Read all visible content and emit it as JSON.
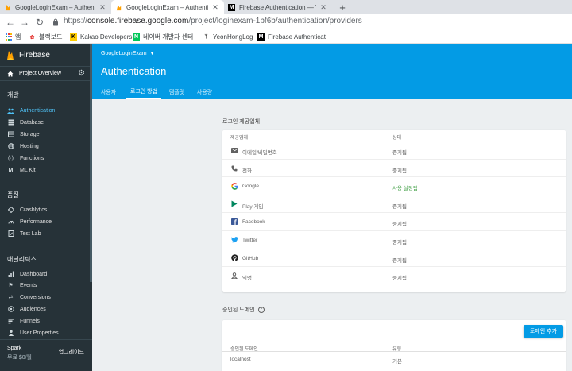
{
  "browser": {
    "tabs": [
      {
        "title": "GoogleLoginExam – Authentica",
        "icon": "firebase-icon"
      },
      {
        "title": "GoogleLoginExam – Authenticati",
        "icon": "firebase-icon"
      },
      {
        "title": "Firebase Authentication — 'Go",
        "icon": "medium-icon"
      }
    ],
    "url_prefix": "https://",
    "url_host": "console.firebase.google.com",
    "url_path": "/project/loginexam-1bf6b/authentication/providers",
    "bookmarks": [
      {
        "label": "앱",
        "icon": "apps-icon"
      },
      {
        "label": "블랙보드",
        "icon": "blackboard-icon"
      },
      {
        "label": "Kakao Developers",
        "icon": "kakao-icon"
      },
      {
        "label": "네이버 개발자 센터",
        "icon": "naver-icon"
      },
      {
        "label": "YeonHongLog",
        "icon": "velog-icon"
      },
      {
        "label": "Firebase Authenticat",
        "icon": "medium-icon"
      }
    ]
  },
  "sidebar": {
    "brand": "Firebase",
    "overview": "Project Overview",
    "sections": {
      "develop": "개발",
      "quality": "품질",
      "analytics": "애널리틱스"
    },
    "develop_items": [
      "Authentication",
      "Database",
      "Storage",
      "Hosting",
      "Functions",
      "ML Kit"
    ],
    "quality_items": [
      "Crashlytics",
      "Performance",
      "Test Lab"
    ],
    "analytics_items": [
      "Dashboard",
      "Events",
      "Conversions",
      "Audiences",
      "Funnels",
      "User Properties"
    ],
    "plan": "Spark",
    "price": "무료 $0/월",
    "upgrade": "업그레이드"
  },
  "header": {
    "project": "GoogleLoginExam",
    "title": "Authentication",
    "tabs": [
      "사용자",
      "로그인 방법",
      "템플릿",
      "사용량"
    ],
    "active_tab": "로그인 방법"
  },
  "providers": {
    "section_label": "로그인 제공업체",
    "col_provider": "제공업체",
    "col_status": "상태",
    "rows": [
      {
        "name": "이메일/비밀번호",
        "status": "중지됨",
        "enabled": false
      },
      {
        "name": "전화",
        "status": "중지됨",
        "enabled": false
      },
      {
        "name": "Google",
        "status": "사용 설정됨",
        "enabled": true
      },
      {
        "name": "Play 게임",
        "status": "중지됨",
        "enabled": false
      },
      {
        "name": "Facebook",
        "status": "중지됨",
        "enabled": false
      },
      {
        "name": "Twitter",
        "status": "중지됨",
        "enabled": false
      },
      {
        "name": "GitHub",
        "status": "중지됨",
        "enabled": false
      },
      {
        "name": "익명",
        "status": "중지됨",
        "enabled": false
      }
    ]
  },
  "domains": {
    "section_label": "승인된 도메인",
    "add_button": "도메인 추가",
    "col_domain": "승인된 도메인",
    "col_type": "유형",
    "rows": [
      {
        "domain": "localhost",
        "type": "기본"
      }
    ]
  },
  "colors": {
    "header_blue": "#039be5",
    "sidebar_dark": "#263238",
    "active_link": "#4fc3f7",
    "enabled_green": "#43a047"
  }
}
